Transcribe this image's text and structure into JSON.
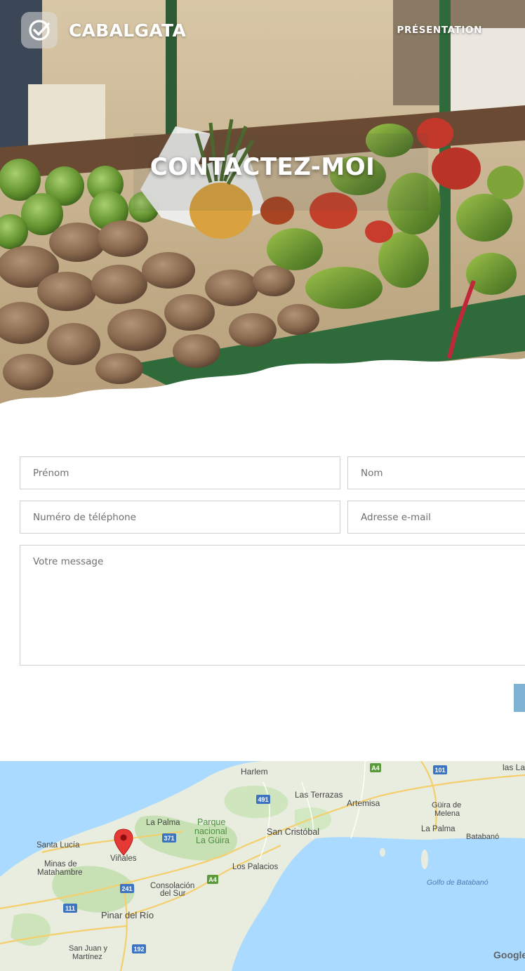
{
  "brand": {
    "name": "CABALGATA",
    "logo_icon": "check-circle-icon"
  },
  "nav": {
    "items": [
      {
        "label": "PRÉSENTATION"
      }
    ]
  },
  "hero": {
    "title": "CONTACTEZ-MOI"
  },
  "form": {
    "first_name_placeholder": "Prénom",
    "last_name_placeholder": "Nom",
    "phone_placeholder": "Numéro de téléphone",
    "email_placeholder": "Adresse e-mail",
    "message_placeholder": "Votre message",
    "submit_color": "#7fb3d3"
  },
  "map": {
    "marker": "map-pin-icon",
    "attribution": "Google",
    "places": [
      "Harlem",
      "Las Terrazas",
      "Artemisa",
      "Güira de",
      "Melena",
      "las La",
      "La Palma",
      "La Palma",
      "Parque",
      "nacional",
      "La Güira",
      "San Cristóbal",
      "Santa Lucía",
      "Viñales",
      "Minas de",
      "Matahambre",
      "Los Palacios",
      "Batabanó",
      "Golfo de Batabanó",
      "Consolación",
      "del Sur",
      "Pinar del Río",
      "San Juan y",
      "Martínez"
    ],
    "road_shields": [
      "A4",
      "101",
      "491",
      "371",
      "A4",
      "241",
      "111",
      "192"
    ]
  }
}
